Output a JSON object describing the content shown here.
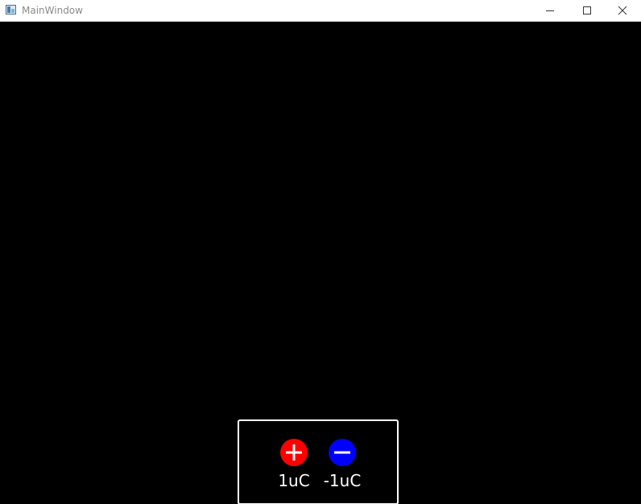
{
  "window": {
    "title": "MainWindow",
    "icon": "app-window-icon",
    "controls": {
      "minimize_icon": "minimize-icon",
      "maximize_icon": "maximize-icon",
      "close_icon": "close-icon"
    }
  },
  "canvas": {
    "background": "#000000"
  },
  "palette": {
    "border_color": "#ffffff",
    "items": [
      {
        "label": "1uC",
        "icon": "plus-icon",
        "color": "#ff0000"
      },
      {
        "label": "-1uC",
        "icon": "minus-icon",
        "color": "#0000ff"
      }
    ]
  }
}
